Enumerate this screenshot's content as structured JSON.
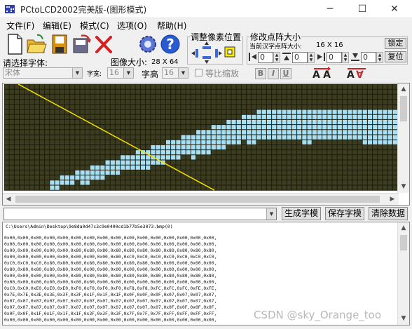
{
  "window": {
    "title": "PCtoLCD2002完美版-(图形模式)",
    "min_glyph": "─",
    "max_glyph": "☐",
    "close_glyph": "✕"
  },
  "menu": [
    "文件(F)",
    "编辑(E)",
    "模式(C)",
    "选项(O)",
    "帮助(H)"
  ],
  "toolbar": {
    "adjust_label": "调整像素位置",
    "modify_label": "修改点阵大小",
    "current_char_size_label": "当前汉字点阵大小:",
    "current_size": "16  X  16",
    "lock_button": "锁定",
    "restore_button": "复位",
    "spin_values": [
      "0",
      "0",
      "0",
      "0"
    ],
    "select_font_label": "请选择字体:",
    "font_value": "宋体",
    "char_width_label": "字宽:",
    "char_width_value": "16",
    "image_size_label": "图像大小:",
    "image_size_value": "28 X 64",
    "char_height_label": "字高",
    "char_height_value": "16",
    "proportional_label": "等比缩放",
    "style_buttons": [
      "B",
      "I",
      "U"
    ]
  },
  "buttons": {
    "generate": "生成字模",
    "save": "保存字模",
    "clear": "清除数据"
  },
  "output": {
    "path": "C:\\Users\\Admin\\Desktop\\9e8da0d47c3c9e0400cd1b77b5e3073.bmp(0)",
    "lines": [
      "0x00,0x00,0x00,0x00,0x00,0x00,0x00,0x00,0x00,0x00,0x00,0x00,0x00,0x00,0x00,0x00,",
      "0x00,0x00,0x00,0x00,0x00,0x00,0x00,0x00,0x00,0x00,0x00,0x00,0x00,0x00,0x00,0x00,",
      "0x00,0x00,0x00,0x00,0x00,0x80,0x80,0x80,0x80,0x80,0x80,0x80,0x80,0x80,0x80,0x80,",
      "0x00,0x00,0x00,0x00,0x00,0x00,0x00,0x00,0x80,0xC0,0xC0,0xC0,0xC0,0xC0,0xC0,0xC0,",
      "0xC0,0xC0,0xC0,0x80,0x80,0x80,0x80,0x80,0x80,0x80,0x80,0x80,0x00,0x00,0x00,0x00,",
      "0x80,0x80,0x80,0x80,0x80,0x00,0x00,0x00,0x00,0x00,0x00,0x00,0x00,0x00,0x00,0x00,",
      "0x00,0x00,0x00,0x00,0x00,0x80,0x80,0x80,0x80,0x80,0x80,0x80,0x80,0x80,0x80,0x80,",
      "0x00,0x00,0x00,0x00,0x00,0x00,0x00,0x00,0x00,0x00,0x00,0x00,0x00,0x00,0x00,0x00,",
      "0xC0,0xC0,0xE0,0xE0,0xE0,0xF0,0xF0,0xF0,0xF0,0xF8,0xF8,0xFC,0xFC,0xFC,0xFE,0xFE,",
      "0x7E,0x7E,0x3E,0x3E,0x3F,0x3F,0x1F,0x1F,0x1F,0x0F,0x0F,0x0F,0x07,0x07,0x07,0x07,",
      "0x07,0x07,0x07,0x07,0x07,0x07,0x07,0x07,0x07,0x07,0x07,0x07,0x07,0x07,0x07,0x07,",
      "0x07,0x07,0x07,0x07,0x07,0x07,0x07,0x07,0x07,0x07,0x07,0x07,0x0F,0x0F,0x0F,0x0F,",
      "0x0F,0x0F,0x1F,0x1F,0x1F,0x1F,0x3F,0x3F,0x3F,0x7F,0x7F,0x7F,0xFF,0xFF,0xFF,0xFF,",
      "0x00,0x00,0x00,0x00,0x00,0x00,0x00,0x00,0x00,0x00,0x00,0x00,0x00,0x00,0x00,0x00,"
    ]
  },
  "watermark": "CSDN @sky_Orange_too",
  "colors": {
    "grid_background": "#3c3c20",
    "grid_lines": "#1c1c0c",
    "lit_pixel": "#a9dff3",
    "guide_line": "#f4e000"
  }
}
